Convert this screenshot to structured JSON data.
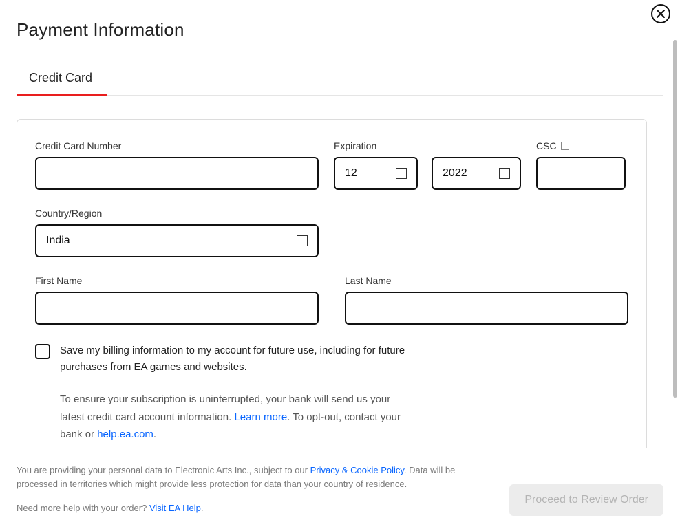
{
  "header": {
    "title": "Payment Information"
  },
  "tabs": {
    "credit_card": "Credit Card"
  },
  "form": {
    "card_number_label": "Credit Card Number",
    "expiration_label": "Expiration",
    "exp_month": "12",
    "exp_year": "2022",
    "csc_label": "CSC",
    "country_label": "Country/Region",
    "country_value": "India",
    "first_name_label": "First Name",
    "last_name_label": "Last Name",
    "save_text": "Save my billing information to my account for future use, including for future purchases from EA games and websites.",
    "info_part1": "To ensure your subscription is uninterrupted, your bank will send us your latest credit card account information. ",
    "learn_more": "Learn more",
    "info_part2": ". To opt-out, contact your bank or ",
    "help_link": "help.ea.com",
    "info_part3": "."
  },
  "footer": {
    "personal_data_1": "You are providing your personal data to Electronic Arts Inc., subject to our ",
    "privacy_link": "Privacy & Cookie Policy",
    "personal_data_2": ". Data will be processed in territories which might provide less protection for data than your country of residence.",
    "help_prompt": "Need more help with your order? ",
    "visit_help": "Visit EA Help",
    "help_period": ".",
    "proceed_label": "Proceed to Review Order"
  }
}
